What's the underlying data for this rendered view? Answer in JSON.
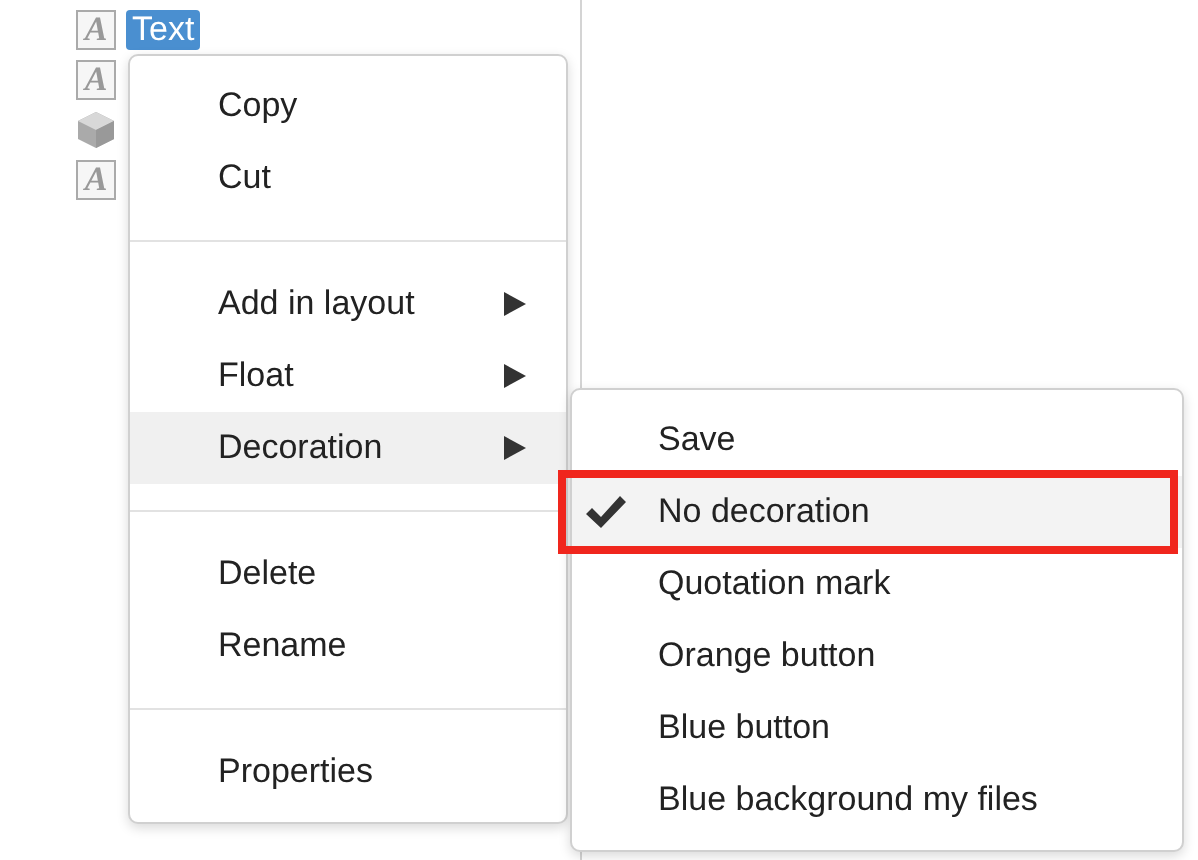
{
  "tree": {
    "items": [
      {
        "kind": "text",
        "glyph": "A",
        "label": "Text",
        "selected": true
      },
      {
        "kind": "text",
        "glyph": "A",
        "selected": false
      },
      {
        "kind": "cube",
        "selected": false
      },
      {
        "kind": "text",
        "glyph": "A",
        "selected": false
      }
    ]
  },
  "context_menu": {
    "groups": [
      [
        {
          "label": "Copy",
          "submenu": false,
          "selected": false
        },
        {
          "label": "Cut",
          "submenu": false,
          "selected": false
        }
      ],
      [
        {
          "label": "Add in layout",
          "submenu": true,
          "selected": false
        },
        {
          "label": "Float",
          "submenu": true,
          "selected": false
        },
        {
          "label": "Decoration",
          "submenu": true,
          "selected": true
        }
      ],
      [
        {
          "label": "Delete",
          "submenu": false,
          "selected": false
        },
        {
          "label": "Rename",
          "submenu": false,
          "selected": false
        }
      ],
      [
        {
          "label": "Properties",
          "submenu": false,
          "selected": false
        }
      ]
    ]
  },
  "submenu": {
    "items": [
      {
        "label": "Save",
        "checked": false,
        "annotated": false
      },
      {
        "label": "No decoration",
        "checked": true,
        "annotated": true
      },
      {
        "label": "Quotation mark",
        "checked": false,
        "annotated": false
      },
      {
        "label": "Orange button",
        "checked": false,
        "annotated": false
      },
      {
        "label": "Blue button",
        "checked": false,
        "annotated": false
      },
      {
        "label": "Blue background my files",
        "checked": false,
        "annotated": false
      }
    ]
  }
}
